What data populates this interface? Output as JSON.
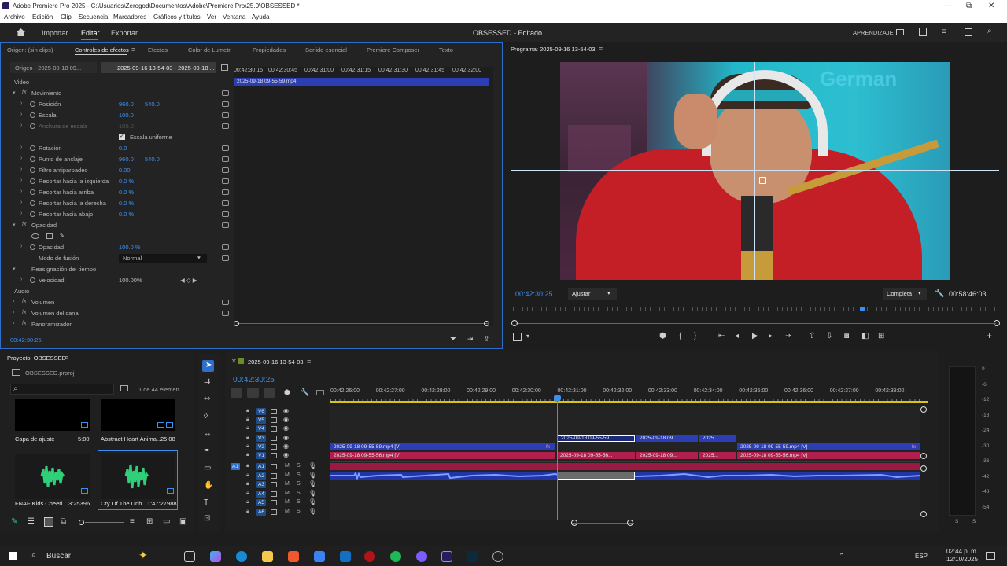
{
  "window": {
    "title": "Adobe Premiere Pro 2025 - C:\\Usuarios\\Zerogod\\Documentos\\Adobe\\Premiere Pro\\25.0\\OBSESSED *",
    "min": "—",
    "max": "⧉",
    "close": "✕"
  },
  "menu": [
    "Archivo",
    "Edición",
    "Clip",
    "Secuencia",
    "Marcadores",
    "Gráficos y títulos",
    "Ver",
    "Ventana",
    "Ayuda"
  ],
  "appbar": {
    "home_icon": "home-icon",
    "workspaces": [
      "Importar",
      "Editar",
      "Exportar"
    ],
    "active_workspace": "Editar",
    "project_title": "OBSESSED - Editado",
    "learning": "APRENDIZAJE"
  },
  "source_panel": {
    "tabs": [
      "Origen: (sin clips)",
      "Controles de efectos",
      "Efectos",
      "Color de Lumetri",
      "Propiedades",
      "Sonido esencial",
      "Premiere Composer",
      "Texto"
    ],
    "active_tab": "Controles de efectos",
    "menu_icon": "≡",
    "subtabs": [
      "Origen - 2025-09-18 09...",
      "2025-09-16 13-54-03 - 2025-09-18 ..."
    ],
    "mini_ruler": [
      "00:42:30:15",
      "00:42:30:45",
      "00:42:31:00",
      "00:42:31:15",
      "00:42:31:30",
      "00:42:31:45",
      "00:42:32:00"
    ],
    "mini_clip": "2025-09-18 09-55-59.mp4",
    "timecode": "00:42:30:25",
    "sections": {
      "video": "Video",
      "audio": "Audio"
    },
    "rows": [
      {
        "label": "Movimiento",
        "fx": true,
        "level": 0
      },
      {
        "label": "Posición",
        "v1": "960.0",
        "v2": "540.0",
        "level": 1
      },
      {
        "label": "Escala",
        "v1": "100.0",
        "level": 1
      },
      {
        "label": "Anchura de escala",
        "v1": "100.0",
        "level": 1,
        "disabled": true
      },
      {
        "label": "Escala uniforme",
        "checkbox": true,
        "level": 1
      },
      {
        "label": "Rotación",
        "v1": "0.0",
        "level": 1
      },
      {
        "label": "Punto de anclaje",
        "v1": "960.0",
        "v2": "540.0",
        "level": 1
      },
      {
        "label": "Filtro antiparpadeo",
        "v1": "0.00",
        "level": 1
      },
      {
        "label": "Recortar hacia la izquierda",
        "v1": "0.0 %",
        "level": 1
      },
      {
        "label": "Recortar hacia arriba",
        "v1": "0.0 %",
        "level": 1
      },
      {
        "label": "Recortar hacia la derecha",
        "v1": "0.0 %",
        "level": 1
      },
      {
        "label": "Recortar hacia abajo",
        "v1": "0.0 %",
        "level": 1
      },
      {
        "label": "Opacidad",
        "fx": true,
        "level": 0
      },
      {
        "label": "",
        "masks": true,
        "level": 1
      },
      {
        "label": "Opacidad",
        "v1": "100.0 %",
        "level": 1
      },
      {
        "label": "Modo de fusión",
        "dropdown": "Normal",
        "level": 1
      },
      {
        "label": "Reasignación del tiempo",
        "level": 0
      },
      {
        "label": "Velocidad",
        "speed": "100.00%",
        "level": 1
      }
    ],
    "audio_rows": [
      "Volumen",
      "Volumen del canal",
      "Panoramizador"
    ]
  },
  "program": {
    "title": "Programa: 2025-09-16 13-54-03",
    "timecode_left": "00:42:30:25",
    "fit": "Ajustar",
    "resolution": "Completa",
    "timecode_right": "00:58:46:03",
    "overlay_text": "German"
  },
  "project": {
    "title": "Proyecto: OBSESSED",
    "file": "OBSESSED.prproj",
    "count": "1 de 44 elemen...",
    "items": [
      {
        "name": "Capa de ajuste",
        "dur": "5:00",
        "kind": "black"
      },
      {
        "name": "Abstract Heart Anima...",
        "dur": "25:08",
        "kind": "black"
      },
      {
        "name": "FNAF Kids Cheeri...",
        "dur": "3:25396",
        "kind": "audio"
      },
      {
        "name": "Cry Of The Unh...",
        "dur": "1:47:27988",
        "kind": "audio"
      }
    ]
  },
  "timeline": {
    "sequence": "2025-09-16 13-54-03",
    "timecode": "00:42:30:25",
    "ruler": [
      "00:42:26:00",
      "00:42:27:00",
      "00:42:28:00",
      "00:42:29:00",
      "00:42:30:00",
      "00:42:31:00",
      "00:42:32:00",
      "00:42:33:00",
      "00:42:34:00",
      "00:42:35:00",
      "00:42:36:00",
      "00:42:37:00",
      "00:42:38:00"
    ],
    "video_tracks": [
      "V6",
      "V5",
      "V4",
      "V3",
      "V2",
      "V1"
    ],
    "audio_tracks": [
      "A1",
      "A2",
      "A3",
      "A4",
      "A5",
      "A6"
    ],
    "clips": {
      "v3_a": "2025-09-18 09-55-59...",
      "v3_b": "2025-09-18 09...",
      "v3_c": "2025...",
      "v2_a": "2025-09-18 09-55-59.mp4 [V]",
      "v2_b": "2025-09-18 09-55-59.mp4 [V]",
      "v1_a": "2025-09-18 09-55-56.mp4 [V]",
      "v1_b": "2025-09-18 09-55-56...",
      "v1_c": "2025-09-18 09...",
      "v1_d": "2025...",
      "v1_e": "2025-09-18 09-55-56.mp4 [V]"
    },
    "fx": "fx"
  },
  "meter": {
    "labels": [
      "0",
      "-6",
      "-12",
      "-18",
      "-24",
      "-30",
      "-36",
      "-42",
      "-48",
      "-54"
    ],
    "ss": [
      "S",
      "S"
    ]
  },
  "taskbar": {
    "search": "Buscar",
    "lang": "ESP",
    "time": "02:44 p. m.",
    "date": "12/10/2025"
  },
  "colors": {
    "accent": "#2d8ceb",
    "video_clip": "#2c3eb4",
    "video_clip_pink": "#b0204e",
    "audio_clip": "#2135a8"
  }
}
